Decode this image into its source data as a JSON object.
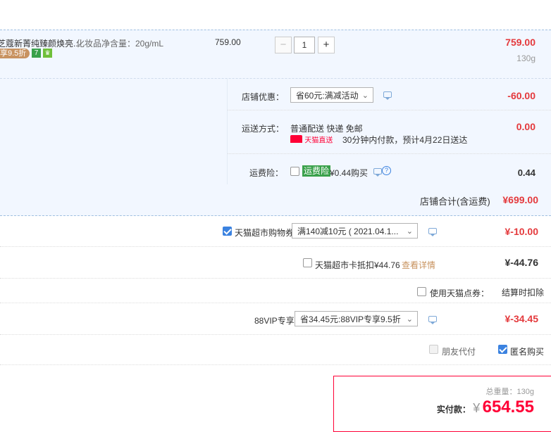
{
  "item": {
    "title": "芝蔻新菁纯臻颜焕亮...",
    "spec": "化妆品净含量：20g/mL",
    "badge": "享9.5折",
    "badge_icon_1": "7",
    "badge_icon_2": "♛",
    "unit_price": "759.00",
    "qty_minus": "−",
    "qty": "1",
    "qty_plus": "+",
    "total": "759.00",
    "weight": "130g"
  },
  "shop": {
    "discount_label": "店铺优惠：",
    "discount_select": "省60元:满减活动",
    "discount_amount": "-60.00",
    "shipping_label": "运送方式：",
    "shipping_method": "普通配送 快递 免邮",
    "shipping_badge": "天猫直送",
    "shipping_note": "30分钟内付款，预计4月22日送达",
    "shipping_amount": "0.00",
    "insurance_label": "运费险：",
    "insurance_badge": "运费险",
    "insurance_text": "¥0.44购买",
    "insurance_amount": "0.44",
    "subtotal_label": "店铺合计(含运费)",
    "subtotal_value": "¥699.00"
  },
  "coupons": {
    "supermarket_coupon_label": "天猫超市购物券",
    "supermarket_coupon_select": "满140减10元 ( 2021.04.1...",
    "supermarket_coupon_amount": "¥-10.00",
    "card_label": "天猫超市卡抵扣¥44.76",
    "card_link": "查看详情",
    "card_amount": "¥-44.76",
    "points_label": "使用天猫点券：",
    "points_note": "结算时扣除",
    "vip_label": "88VIP专享",
    "vip_select": "省34.45元:88VIP专享9.5折",
    "vip_amount": "¥-34.45",
    "friend_pay": "朋友代付",
    "anonymous": "匿名购买"
  },
  "summary": {
    "weight_label": "总重量：",
    "weight_value": "130g",
    "pay_label": "实付款：",
    "currency": "¥",
    "pay_value": "654.55"
  },
  "colors": {
    "accent_red": "#e4393c",
    "link_blue": "#3b82e0",
    "tmall_red": "#ff0036",
    "green": "#3aa14b"
  }
}
